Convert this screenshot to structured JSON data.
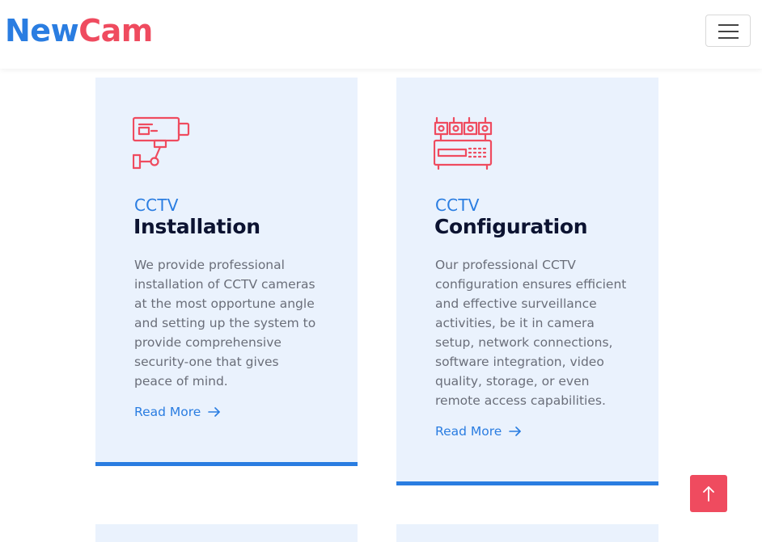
{
  "brand": {
    "part1": "New",
    "part2": "Cam",
    "color_primary": "#2a7de1",
    "color_accent": "#ef4b5f"
  },
  "nav": {
    "toggler_icon": "hamburger-menu-icon"
  },
  "cards": [
    {
      "icon": "cctv-camera-icon",
      "eyebrow": "CCTV",
      "title": "Installation",
      "description": "We provide professional installation of CCTV cameras at the most opportune angle and setting up the system to provide comprehensive security-one that gives peace of mind.",
      "link": "Read More"
    },
    {
      "icon": "dvr-recorder-icon",
      "eyebrow": "CCTV",
      "title": "Configuration",
      "description": "Our professional CCTV configuration ensures efficient and effective surveillance activities, be it in camera setup, network connections, software integration, video quality, storage, or even remote access capabilities.",
      "link": "Read More"
    }
  ],
  "back_to_top": {
    "icon": "arrow-up-icon"
  }
}
